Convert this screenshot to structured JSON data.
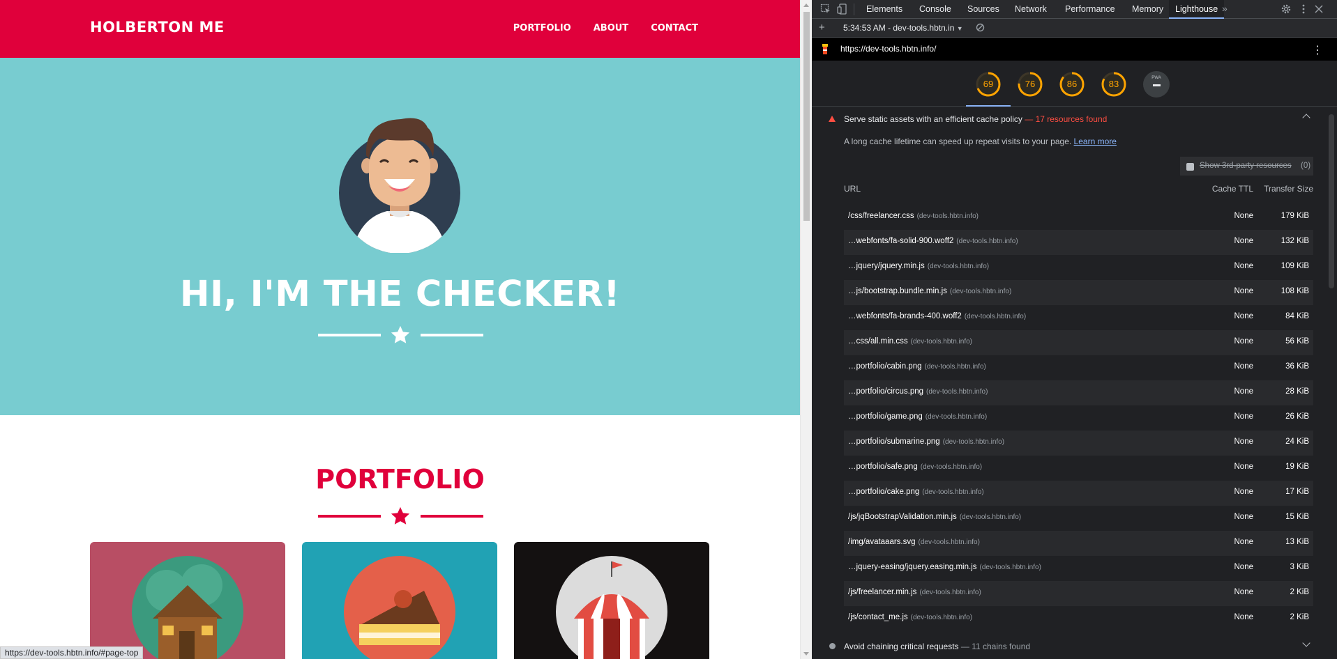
{
  "site": {
    "brand": "HOLBERTON ME",
    "nav": [
      "PORTFOLIO",
      "ABOUT",
      "CONTACT"
    ],
    "hero_title": "HI, I'M THE CHECKER!",
    "portfolio_title": "PORTFOLIO",
    "status_url": "https://dev-tools.hbtn.info/#page-top",
    "colors": {
      "primary": "#e0003b",
      "hero": "#78ccd0"
    }
  },
  "devtools": {
    "tabs": [
      "Elements",
      "Console",
      "Sources",
      "Network",
      "Performance",
      "Memory",
      "Lighthouse"
    ],
    "active_tab": "Lighthouse",
    "report_label": "5:34:53 AM - dev-tools.hbtn.in",
    "url": "https://dev-tools.hbtn.info/",
    "scores": [
      "69",
      "76",
      "86",
      "83"
    ],
    "pwa_label": "PWA",
    "audit": {
      "title": "Serve static assets with an efficient cache policy",
      "found": "— 17 resources found",
      "description": "A long cache lifetime can speed up repeat visits to your page.",
      "learn_more": "Learn more",
      "third_party_label": "Show 3rd-party resources",
      "third_party_count": "(0)",
      "columns": {
        "url": "URL",
        "ttl": "Cache TTL",
        "size": "Transfer Size"
      },
      "rows": [
        {
          "url": "/css/freelancer.css",
          "host": "(dev-tools.hbtn.info)",
          "ttl": "None",
          "size": "179 KiB"
        },
        {
          "url": "…webfonts/fa-solid-900.woff2",
          "host": "(dev-tools.hbtn.info)",
          "ttl": "None",
          "size": "132 KiB"
        },
        {
          "url": "…jquery/jquery.min.js",
          "host": "(dev-tools.hbtn.info)",
          "ttl": "None",
          "size": "109 KiB"
        },
        {
          "url": "…js/bootstrap.bundle.min.js",
          "host": "(dev-tools.hbtn.info)",
          "ttl": "None",
          "size": "108 KiB"
        },
        {
          "url": "…webfonts/fa-brands-400.woff2",
          "host": "(dev-tools.hbtn.info)",
          "ttl": "None",
          "size": "84 KiB"
        },
        {
          "url": "…css/all.min.css",
          "host": "(dev-tools.hbtn.info)",
          "ttl": "None",
          "size": "56 KiB"
        },
        {
          "url": "…portfolio/cabin.png",
          "host": "(dev-tools.hbtn.info)",
          "ttl": "None",
          "size": "36 KiB"
        },
        {
          "url": "…portfolio/circus.png",
          "host": "(dev-tools.hbtn.info)",
          "ttl": "None",
          "size": "28 KiB"
        },
        {
          "url": "…portfolio/game.png",
          "host": "(dev-tools.hbtn.info)",
          "ttl": "None",
          "size": "26 KiB"
        },
        {
          "url": "…portfolio/submarine.png",
          "host": "(dev-tools.hbtn.info)",
          "ttl": "None",
          "size": "24 KiB"
        },
        {
          "url": "…portfolio/safe.png",
          "host": "(dev-tools.hbtn.info)",
          "ttl": "None",
          "size": "19 KiB"
        },
        {
          "url": "…portfolio/cake.png",
          "host": "(dev-tools.hbtn.info)",
          "ttl": "None",
          "size": "17 KiB"
        },
        {
          "url": "/js/jqBootstrapValidation.min.js",
          "host": "(dev-tools.hbtn.info)",
          "ttl": "None",
          "size": "15 KiB"
        },
        {
          "url": "/img/avataaars.svg",
          "host": "(dev-tools.hbtn.info)",
          "ttl": "None",
          "size": "13 KiB"
        },
        {
          "url": "…jquery-easing/jquery.easing.min.js",
          "host": "(dev-tools.hbtn.info)",
          "ttl": "None",
          "size": "3 KiB"
        },
        {
          "url": "/js/freelancer.min.js",
          "host": "(dev-tools.hbtn.info)",
          "ttl": "None",
          "size": "2 KiB"
        },
        {
          "url": "/js/contact_me.js",
          "host": "(dev-tools.hbtn.info)",
          "ttl": "None",
          "size": "2 KiB"
        }
      ]
    },
    "next_audit": {
      "title": "Avoid chaining critical requests",
      "found": "— 11 chains found"
    },
    "score_color": "#ffa400"
  }
}
